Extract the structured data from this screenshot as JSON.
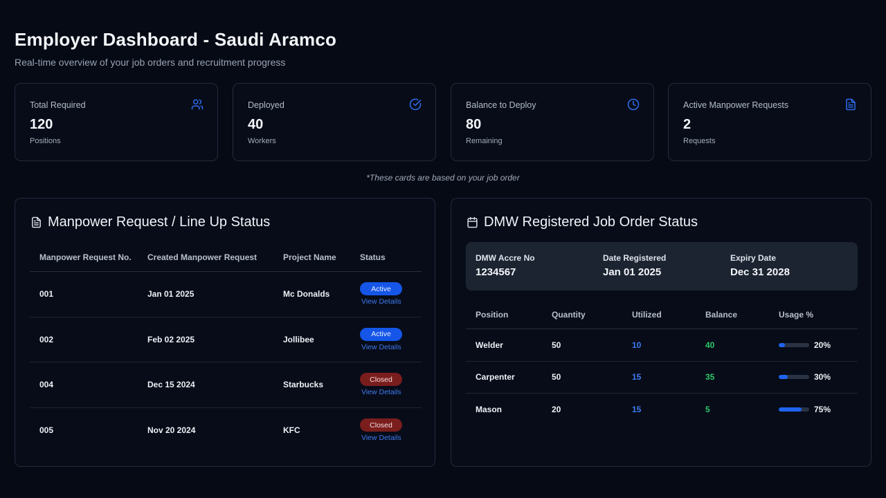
{
  "header": {
    "title": "Employer Dashboard - Saudi Aramco",
    "subtitle": "Real-time overview of your job orders and recruitment progress"
  },
  "colors": {
    "accent": "#1e64f0",
    "active": "#1556e8",
    "closed": "#7a1d1d",
    "utilized": "#3f7cf2",
    "balance": "#2fc86a"
  },
  "cards": [
    {
      "label": "Total Required",
      "value": "120",
      "unit": "Positions",
      "icon": "users-icon"
    },
    {
      "label": "Deployed",
      "value": "40",
      "unit": "Workers",
      "icon": "check-circle-icon"
    },
    {
      "label": "Balance to Deploy",
      "value": "80",
      "unit": "Remaining",
      "icon": "clock-icon"
    },
    {
      "label": "Active Manpower Requests",
      "value": "2",
      "unit": "Requests",
      "icon": "document-icon"
    }
  ],
  "cards_note": "*These cards are based on your job order",
  "manpower": {
    "title": "Manpower Request / Line Up Status",
    "columns": [
      "Manpower Request No.",
      "Created Manpower Request",
      "Project Name",
      "Status"
    ],
    "view_label": "View Details",
    "rows": [
      {
        "no": "001",
        "created": "Jan 01 2025",
        "project": "Mc Donalds",
        "status": "Active"
      },
      {
        "no": "002",
        "created": "Feb 02 2025",
        "project": "Jollibee",
        "status": "Active"
      },
      {
        "no": "004",
        "created": "Dec 15 2024",
        "project": "Starbucks",
        "status": "Closed"
      },
      {
        "no": "005",
        "created": "Nov 20 2024",
        "project": "KFC",
        "status": "Closed"
      }
    ]
  },
  "dmw": {
    "title": "DMW Registered Job Order Status",
    "accr_label": "DMW Accre No",
    "accr_value": "1234567",
    "registered_label": "Date Registered",
    "registered_value": "Jan 01 2025",
    "expiry_label": "Expiry Date",
    "expiry_value": "Dec 31 2028",
    "columns": [
      "Position",
      "Quantity",
      "Utilized",
      "Balance",
      "Usage %"
    ],
    "rows": [
      {
        "position": "Welder",
        "quantity": "50",
        "utilized": "10",
        "balance": "40",
        "usage": "20%",
        "usage_value": 20
      },
      {
        "position": "Carpenter",
        "quantity": "50",
        "utilized": "15",
        "balance": "35",
        "usage": "30%",
        "usage_value": 30
      },
      {
        "position": "Mason",
        "quantity": "20",
        "utilized": "15",
        "balance": "5",
        "usage": "75%",
        "usage_value": 75
      }
    ]
  }
}
